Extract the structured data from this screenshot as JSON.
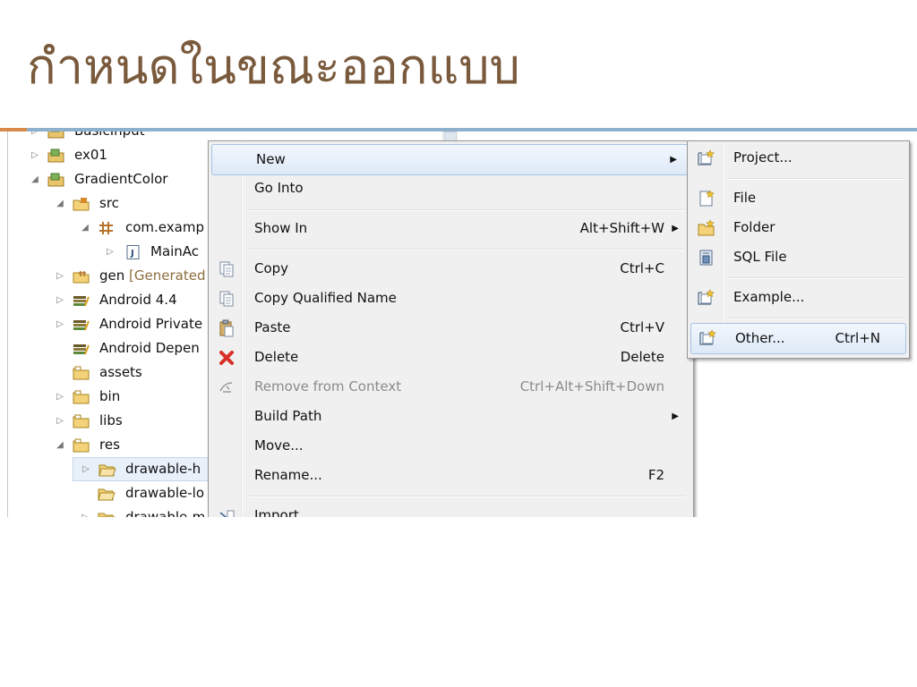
{
  "slide": {
    "title": "กำหนดในขณะออกแบบ"
  },
  "tree": {
    "items": [
      {
        "label": "BasicInput",
        "decoration": "",
        "icon": "android-project-icon"
      },
      {
        "label": "ex01",
        "decoration": "",
        "icon": "android-project-icon"
      },
      {
        "label": "GradientColor",
        "decoration": "",
        "icon": "android-project-icon"
      },
      {
        "label": "src",
        "decoration": "",
        "icon": "source-folder-icon"
      },
      {
        "label": "com.examp",
        "decoration": "",
        "icon": "package-icon"
      },
      {
        "label": "MainAc",
        "decoration": "",
        "icon": "java-file-icon"
      },
      {
        "label": "gen ",
        "decoration": "[Generated",
        "icon": "source-folder-icon"
      },
      {
        "label": "Android 4.4",
        "decoration": "",
        "icon": "library-icon"
      },
      {
        "label": "Android Private",
        "decoration": "",
        "icon": "library-icon"
      },
      {
        "label": "Android Depen",
        "decoration": "",
        "icon": "library-icon"
      },
      {
        "label": "assets",
        "decoration": "",
        "icon": "folder-icon"
      },
      {
        "label": "bin",
        "decoration": "",
        "icon": "folder-icon"
      },
      {
        "label": "libs",
        "decoration": "",
        "icon": "folder-icon"
      },
      {
        "label": "res",
        "decoration": "",
        "icon": "folder-icon"
      },
      {
        "label": "drawable-h",
        "decoration": "",
        "icon": "folder-icon"
      },
      {
        "label": "drawable-lo",
        "decoration": "",
        "icon": "folder-icon"
      },
      {
        "label": "drawable-m",
        "decoration": "",
        "icon": "folder-icon"
      }
    ]
  },
  "menu": {
    "items": [
      {
        "label": "New",
        "shortcut": "",
        "submenu": true,
        "highlighted": true
      },
      {
        "label": "Go Into",
        "shortcut": ""
      },
      {
        "label": "Show In",
        "shortcut": "Alt+Shift+W",
        "submenu": true
      },
      {
        "label": "Copy",
        "shortcut": "Ctrl+C",
        "icon": "copy-icon"
      },
      {
        "label": "Copy Qualified Name",
        "shortcut": "",
        "icon": "copy-qualified-name-icon"
      },
      {
        "label": "Paste",
        "shortcut": "Ctrl+V",
        "icon": "paste-icon"
      },
      {
        "label": "Delete",
        "shortcut": "Delete",
        "icon": "delete-icon"
      },
      {
        "label": "Remove from Context",
        "shortcut": "Ctrl+Alt+Shift+Down",
        "disabled": true,
        "icon": "remove-context-icon"
      },
      {
        "label": "Build Path",
        "shortcut": "",
        "submenu": true
      },
      {
        "label": "Move...",
        "shortcut": ""
      },
      {
        "label": "Rename...",
        "shortcut": "F2"
      },
      {
        "label": "Import...",
        "shortcut": "",
        "icon": "import-icon"
      }
    ],
    "submenu_arrow": "▶"
  },
  "submenu": {
    "items": [
      {
        "label": "Project...",
        "shortcut": "",
        "icon": "new-project-icon"
      },
      {
        "label": "File",
        "shortcut": "",
        "icon": "new-file-icon"
      },
      {
        "label": "Folder",
        "shortcut": "",
        "icon": "new-folder-icon"
      },
      {
        "label": "SQL File",
        "shortcut": "",
        "icon": "sql-file-icon"
      },
      {
        "label": "Example...",
        "shortcut": "",
        "icon": "new-example-icon"
      },
      {
        "label": "Other...",
        "shortcut": "Ctrl+N",
        "highlighted": true,
        "icon": "new-other-icon"
      }
    ]
  },
  "colors": {
    "title": "#7a5a3c",
    "accent_blue": "#8fb0cc",
    "accent_orange": "#d98a4a",
    "menu_bg": "#f0f0f0",
    "highlight_border": "#a6c3e6",
    "delete_red": "#d9302a"
  }
}
